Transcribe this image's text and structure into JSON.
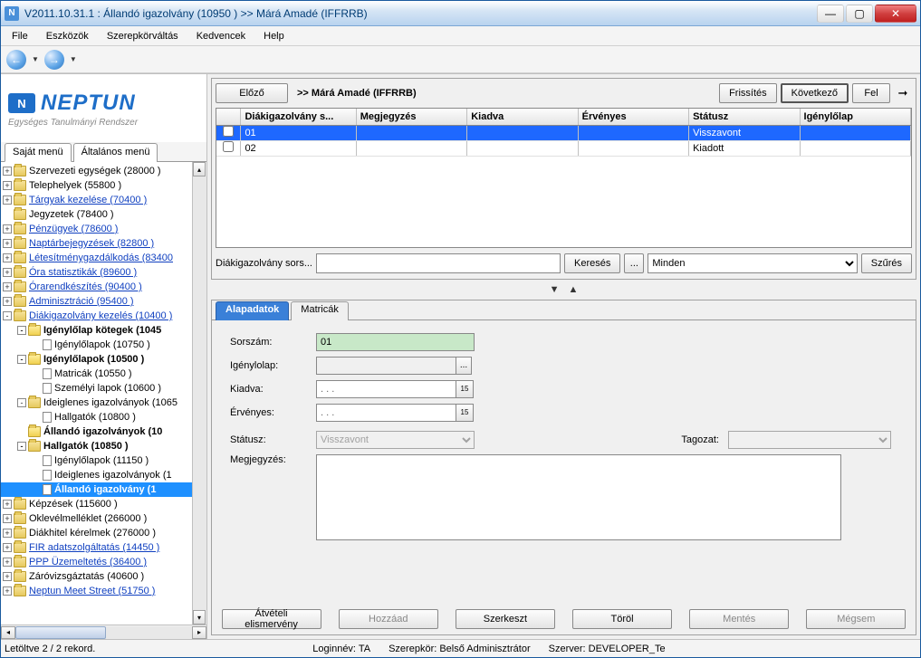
{
  "titlebar": "V2011.10.31.1 : Állandó igazolvány (10950  )  >> Márá Amadé (IFFRRB)",
  "menus": [
    "File",
    "Eszközök",
    "Szerepkörváltás",
    "Kedvencek",
    "Help"
  ],
  "logo": {
    "brand": "NEPTUN",
    "sub": "Egységes Tanulmányi Rendszer"
  },
  "leftTabs": {
    "t1": "Saját menü",
    "t2": "Általános menü"
  },
  "tree": [
    {
      "d": 0,
      "exp": "+",
      "ico": "folder",
      "bold": false,
      "txt": "Szervezeti egységek (28000  )",
      "link": false
    },
    {
      "d": 0,
      "exp": "+",
      "ico": "folder",
      "bold": false,
      "txt": "Telephelyek (55800  )",
      "link": false
    },
    {
      "d": 0,
      "exp": "+",
      "ico": "folder",
      "bold": false,
      "txt": "Tárgyak kezelése (70400  )",
      "link": true
    },
    {
      "d": 0,
      "exp": "",
      "ico": "folder",
      "bold": false,
      "txt": "Jegyzetek (78400  )",
      "link": false
    },
    {
      "d": 0,
      "exp": "+",
      "ico": "folder",
      "bold": false,
      "txt": "Pénzügyek (78600  )",
      "link": true
    },
    {
      "d": 0,
      "exp": "+",
      "ico": "folder",
      "bold": false,
      "txt": "Naptárbejegyzések (82800  )",
      "link": true
    },
    {
      "d": 0,
      "exp": "+",
      "ico": "folder",
      "bold": false,
      "txt": "Létesítménygazdálkodás (83400",
      "link": true
    },
    {
      "d": 0,
      "exp": "+",
      "ico": "folder",
      "bold": false,
      "txt": "Óra statisztikák (89600  )",
      "link": true
    },
    {
      "d": 0,
      "exp": "+",
      "ico": "folder",
      "bold": false,
      "txt": "Órarendkészítés (90400  )",
      "link": true
    },
    {
      "d": 0,
      "exp": "+",
      "ico": "folder",
      "bold": false,
      "txt": "Adminisztráció (95400  )",
      "link": true
    },
    {
      "d": 0,
      "exp": "-",
      "ico": "folder",
      "bold": false,
      "txt": "Diákigazolvány kezelés (10400  )",
      "link": true
    },
    {
      "d": 1,
      "exp": "-",
      "ico": "folder yellow",
      "bold": true,
      "txt": "Igénylőlap kötegek (1045",
      "link": false
    },
    {
      "d": 2,
      "exp": "",
      "ico": "page",
      "bold": false,
      "txt": "Igénylőlapok (10750  )",
      "link": false
    },
    {
      "d": 1,
      "exp": "-",
      "ico": "folder yellow",
      "bold": true,
      "txt": "Igénylőlapok (10500  )",
      "link": false
    },
    {
      "d": 2,
      "exp": "",
      "ico": "page",
      "bold": false,
      "txt": "Matricák (10550  )",
      "link": false
    },
    {
      "d": 2,
      "exp": "",
      "ico": "page",
      "bold": false,
      "txt": "Személyi lapok (10600  )",
      "link": false
    },
    {
      "d": 1,
      "exp": "-",
      "ico": "folder",
      "bold": false,
      "txt": "Ideiglenes igazolványok (1065",
      "link": false
    },
    {
      "d": 2,
      "exp": "",
      "ico": "page",
      "bold": false,
      "txt": "Hallgatók (10800  )",
      "link": false
    },
    {
      "d": 1,
      "exp": "",
      "ico": "folder yellow",
      "bold": true,
      "txt": "Állandó igazolványok (10",
      "link": false
    },
    {
      "d": 1,
      "exp": "-",
      "ico": "folder",
      "bold": true,
      "txt": "Hallgatók (10850  )",
      "link": false
    },
    {
      "d": 2,
      "exp": "",
      "ico": "page",
      "bold": false,
      "txt": "Igénylőlapok (11150  )",
      "link": false
    },
    {
      "d": 2,
      "exp": "",
      "ico": "page",
      "bold": false,
      "txt": "Ideiglenes igazolványok (1",
      "link": false
    },
    {
      "d": 2,
      "exp": "",
      "ico": "page",
      "bold": true,
      "txt": "Állandó igazolvány (1",
      "link": false,
      "sel": true
    },
    {
      "d": 0,
      "exp": "+",
      "ico": "folder",
      "bold": false,
      "txt": "Képzések (115600  )",
      "link": false
    },
    {
      "d": 0,
      "exp": "+",
      "ico": "folder",
      "bold": false,
      "txt": "Oklevélmelléklet (266000  )",
      "link": false
    },
    {
      "d": 0,
      "exp": "+",
      "ico": "folder",
      "bold": false,
      "txt": "Diákhitel kérelmek (276000  )",
      "link": false
    },
    {
      "d": 0,
      "exp": "+",
      "ico": "folder",
      "bold": false,
      "txt": "FIR adatszolgáltatás (14450  )",
      "link": true
    },
    {
      "d": 0,
      "exp": "+",
      "ico": "folder",
      "bold": false,
      "txt": "PPP Üzemeltetés (36400  )",
      "link": true
    },
    {
      "d": 0,
      "exp": "+",
      "ico": "folder",
      "bold": false,
      "txt": "Záróvizsgáztatás (40600  )",
      "link": false
    },
    {
      "d": 0,
      "exp": "+",
      "ico": "folder",
      "bold": false,
      "txt": "Neptun Meet Street (51750  )",
      "link": true
    }
  ],
  "topBar": {
    "prev": "Előző",
    "crumb": ">> Márá Amadé (IFFRRB)",
    "refresh": "Frissítés",
    "next": "Következő",
    "up": "Fel"
  },
  "gridCols": [
    "",
    "Diákigazolvány s...",
    "Megjegyzés",
    "Kiadva",
    "Érvényes",
    "Státusz",
    "Igénylőlap"
  ],
  "gridRows": [
    {
      "sel": true,
      "cells": [
        "01",
        "",
        "",
        "",
        "Visszavont",
        ""
      ]
    },
    {
      "sel": false,
      "cells": [
        "02",
        "",
        "",
        "",
        "Kiadott",
        ""
      ]
    }
  ],
  "searchRow": {
    "label": "Diákigazolvány sors...",
    "btn": "Keresés",
    "ellipsis": "...",
    "dd": "Minden",
    "filter": "Szűrés"
  },
  "bottomTabs": {
    "t1": "Alapadatok",
    "t2": "Matricák"
  },
  "form": {
    "sorszam_lbl": "Sorszám:",
    "sorszam": "01",
    "igenylo_lbl": "Igénylolap:",
    "igenylo": "",
    "kiadva_lbl": "Kiadva:",
    "kiadva": ".   .   .",
    "ervenyes_lbl": "Érvényes:",
    "ervenyes": ".   .   .",
    "statusz_lbl": "Státusz:",
    "statusz": "Visszavont",
    "tagozat_lbl": "Tagozat:",
    "tagozat": "",
    "megj_lbl": "Megjegyzés:",
    "megj": ""
  },
  "bottomButtons": {
    "b1": "Átvételi elismervény",
    "b2": "Hozzáad",
    "b3": "Szerkeszt",
    "b4": "Töröl",
    "b5": "Mentés",
    "b6": "Mégsem"
  },
  "status": {
    "s1": "Letöltve 2 / 2 rekord.",
    "s2": "Loginnév: TA",
    "s3": "Szerepkör: Belső Adminisztrátor",
    "s4": "Szerver: DEVELOPER_Te"
  }
}
